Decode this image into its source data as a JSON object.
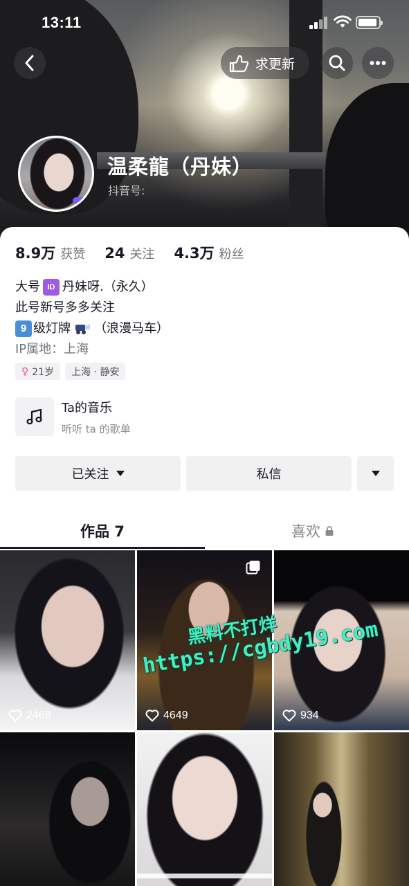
{
  "status_bar": {
    "time": "13:11"
  },
  "header": {
    "update_request_label": "求更新",
    "profile_name": "温柔龍（丹妹）",
    "douyin_id_label": "抖音号:"
  },
  "stats": [
    {
      "value": "8.9万",
      "label": "获赞"
    },
    {
      "value": "24",
      "label": "关注"
    },
    {
      "value": "4.3万",
      "label": "粉丝"
    }
  ],
  "bio": {
    "line1_prefix": "大号",
    "line1_id_emoji": "ID",
    "line1_suffix": "丹妹呀.（永久）",
    "line2": "此号新号多多关注",
    "line3_nine_emoji": "9",
    "line3_prefix": "级灯牌",
    "line3_suffix": "（浪漫马车）",
    "ip_location": "IP属地：上海"
  },
  "tags": {
    "gender_symbol": "♀",
    "age": "21岁",
    "location": "上海 · 静安"
  },
  "music": {
    "title": "Ta的音乐",
    "subtitle": "听听 ta 的歌单"
  },
  "actions": {
    "follow_label": "已关注",
    "message_label": "私信"
  },
  "tabs": {
    "works_label": "作品 7",
    "likes_label": "喜欢"
  },
  "videos": [
    {
      "likes": "2468"
    },
    {
      "likes": "4649"
    },
    {
      "likes": "934"
    }
  ],
  "watermark": {
    "line1": "黑料不打烊",
    "line2": "https://cgbdy19.com"
  },
  "colors": {
    "accent_pink": "#e94a8c",
    "watermark_green": "#3ef0c4",
    "text_primary": "#161823",
    "text_secondary": "#73757c"
  }
}
